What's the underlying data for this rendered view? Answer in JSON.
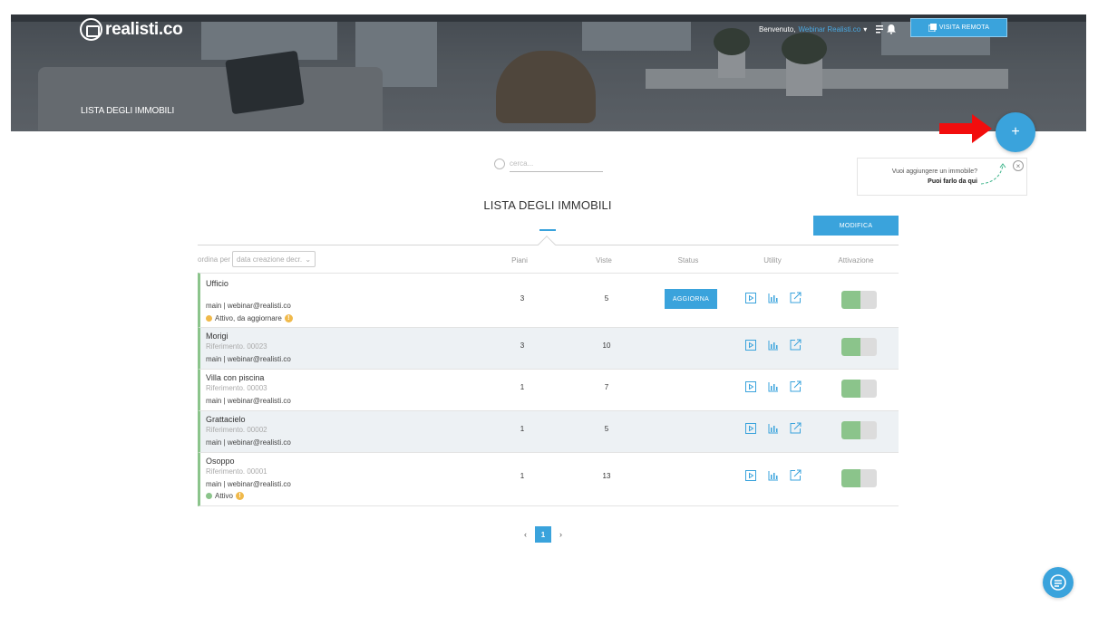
{
  "header": {
    "brand": "realisti.co",
    "page_title": "LISTA DEGLI IMMOBILI",
    "welcome": "Benvenuto,",
    "user_name": "Webinar Realisti.co",
    "remote_visit_label": "VISITA REMOTA",
    "add_label": "+"
  },
  "hint": {
    "line1": "Vuoi aggiungere un immobile?",
    "line2": "Puoi farlo da qui",
    "close": "×"
  },
  "search": {
    "placeholder": "cerca..."
  },
  "list": {
    "title": "LISTA DEGLI IMMOBILI",
    "modify_label": "MODIFICA",
    "sort_label": "ordina per",
    "sort_value": "data creazione decr.",
    "columns": {
      "floors": "Piani",
      "views": "Viste",
      "status": "Status",
      "utility": "Utility",
      "activation": "Attivazione"
    },
    "update_label": "AGGIORNA",
    "rows": [
      {
        "name": "Ufficio",
        "ref": "",
        "owner": "main | webinar@realisti.co",
        "status": "Attivo, da aggiornare",
        "status_color": "#f0b94a",
        "floors": "3",
        "views": "5",
        "active": true
      },
      {
        "name": "Morigi",
        "ref": "Riferimento. 00023",
        "owner": "main | webinar@realisti.co",
        "status": "",
        "floors": "3",
        "views": "10",
        "active": true
      },
      {
        "name": "Villa con piscina",
        "ref": "Riferimento. 00003",
        "owner": "main | webinar@realisti.co",
        "status": "",
        "floors": "1",
        "views": "7",
        "active": true
      },
      {
        "name": "Grattacielo",
        "ref": "Riferimento. 00002",
        "owner": "main | webinar@realisti.co",
        "status": "",
        "floors": "1",
        "views": "5",
        "active": true
      },
      {
        "name": "Osoppo",
        "ref": "Riferimento. 00001",
        "owner": "main | webinar@realisti.co",
        "status": "Attivo",
        "status_color": "#8bc48b",
        "floors": "1",
        "views": "13",
        "active": true
      }
    ]
  },
  "pagination": {
    "prev": "‹",
    "current": "1",
    "next": "›"
  },
  "colors": {
    "accent": "#3aa3dc",
    "active_green": "#8bc48b",
    "warning": "#f0b94a"
  }
}
